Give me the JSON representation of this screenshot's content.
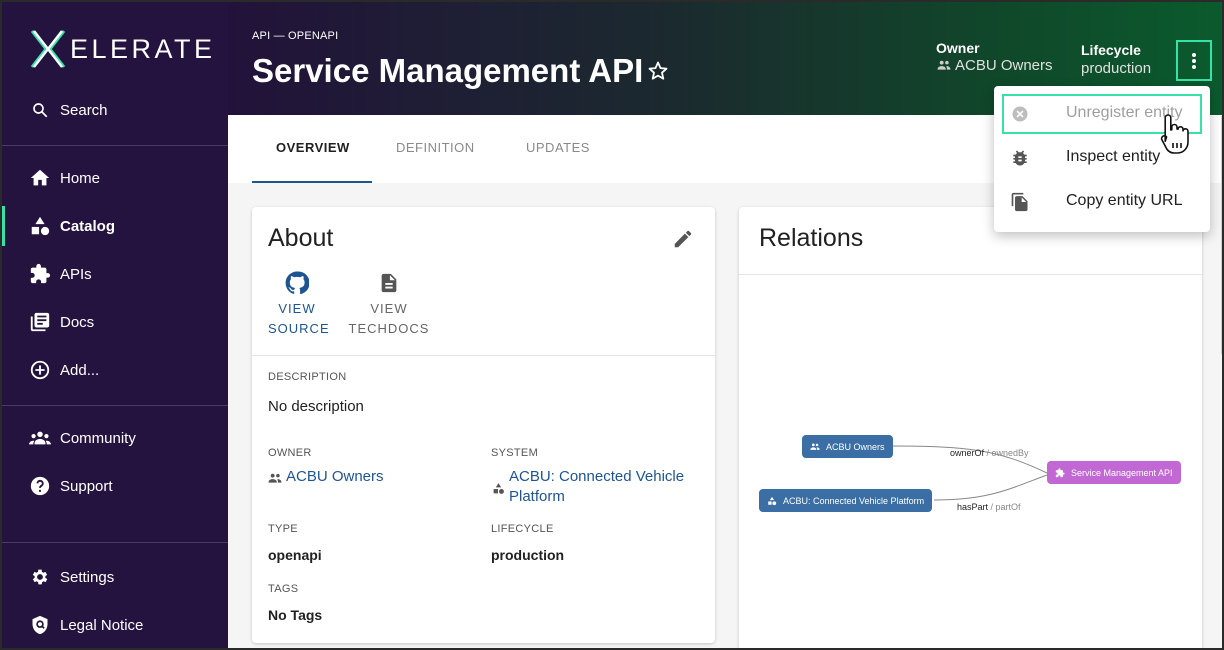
{
  "brand": {
    "logo_text": "ELERATE"
  },
  "sidebar": {
    "search": "Search",
    "items": [
      {
        "label": "Home"
      },
      {
        "label": "Catalog"
      },
      {
        "label": "APIs"
      },
      {
        "label": "Docs"
      },
      {
        "label": "Add..."
      },
      {
        "label": "Community"
      },
      {
        "label": "Support"
      },
      {
        "label": "Settings"
      },
      {
        "label": "Legal Notice"
      }
    ]
  },
  "header": {
    "breadcrumb": "API — OPENAPI",
    "title": "Service Management API",
    "owner_label": "Owner",
    "owner_value": "ACBU Owners",
    "lifecycle_label": "Lifecycle",
    "lifecycle_value": "production"
  },
  "tabs": [
    {
      "label": "OVERVIEW"
    },
    {
      "label": "DEFINITION"
    },
    {
      "label": "UPDATES"
    }
  ],
  "about": {
    "title": "About",
    "view_source_1": "VIEW",
    "view_source_2": "SOURCE",
    "view_techdocs_1": "VIEW",
    "view_techdocs_2": "TECHDOCS",
    "description_label": "DESCRIPTION",
    "description_value": "No description",
    "owner_label": "OWNER",
    "owner_value": "ACBU Owners",
    "system_label": "SYSTEM",
    "system_value_1": "ACBU: Connected Vehicle",
    "system_value_2": "Platform",
    "type_label": "TYPE",
    "type_value": "openapi",
    "lifecycle_label": "LIFECYCLE",
    "lifecycle_value": "production",
    "tags_label": "TAGS",
    "tags_value": "No Tags"
  },
  "relations": {
    "title": "Relations",
    "nodes": {
      "owners": "ACBU Owners",
      "system": "ACBU: Connected Vehicle Platform",
      "api": "Service Management API"
    },
    "edges": {
      "e1_main": "ownerOf",
      "e1_rev": " / ownedBy",
      "e2_main": "hasPart",
      "e2_rev": " / partOf"
    },
    "colors": {
      "group": "#3a6ea5",
      "api": "#c268d4"
    }
  },
  "menu": {
    "items": [
      {
        "label": "Unregister entity",
        "disabled": true
      },
      {
        "label": "Inspect entity"
      },
      {
        "label": "Copy entity URL"
      }
    ]
  },
  "colors": {
    "sidebar": "#25133f",
    "accent": "#36e2a8",
    "link": "#1f5493"
  }
}
